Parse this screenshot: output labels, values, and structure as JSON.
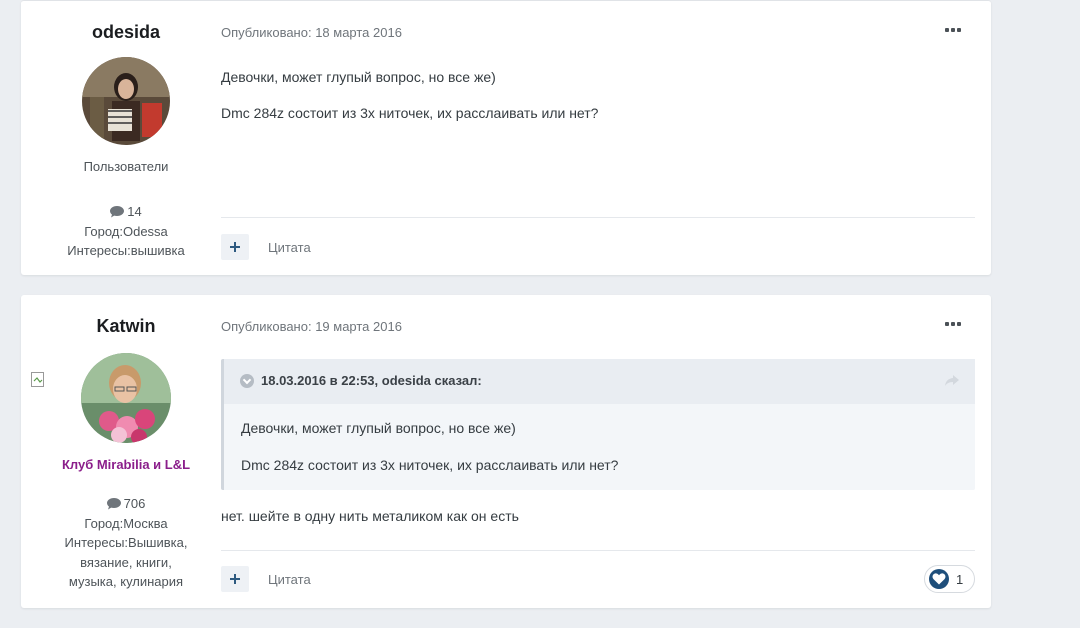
{
  "posts": [
    {
      "author": "odesida",
      "group": "Пользователи",
      "post_count": "14",
      "city": "Город:Odessa",
      "interests": [
        "Интересы:вышивка"
      ],
      "posted": "Опубликовано: 18 марта 2016",
      "body": [
        "Девочки, может глупый вопрос, но все же)",
        "Dmc 284z состоит из 3х ниточек, их расслаивать или нет?"
      ],
      "quote_label": "Цитата"
    },
    {
      "author": "Katwin",
      "group": "Клуб Mirabilia и L&L",
      "post_count": "706",
      "city": "Город:Москва",
      "interests": [
        "Интересы:Вышивка,",
        "вязание, книги,",
        "музыка, кулинария"
      ],
      "posted": "Опубликовано: 19 марта 2016",
      "quote": {
        "citation": "18.03.2016 в 22:53, odesida сказал:",
        "lines": [
          "Девочки, может глупый вопрос, но все же)",
          "Dmc 284z состоит из 3х ниточек, их расслаивать или нет?"
        ]
      },
      "body": [
        "нет. шейте в одну нить металиком как он есть"
      ],
      "quote_label": "Цитата",
      "reaction_count": "1"
    }
  ],
  "colors": {
    "accent": "#2e5a80",
    "club_group": "#8b1e8b",
    "background": "#ebeef2"
  },
  "icons": {
    "post_count": "speech-bubble-icon",
    "menu": "ellipsis-icon",
    "add": "plus-icon",
    "reaction": "heart-icon",
    "quote_toggle": "chevron-down-icon",
    "quote_share": "share-icon"
  }
}
